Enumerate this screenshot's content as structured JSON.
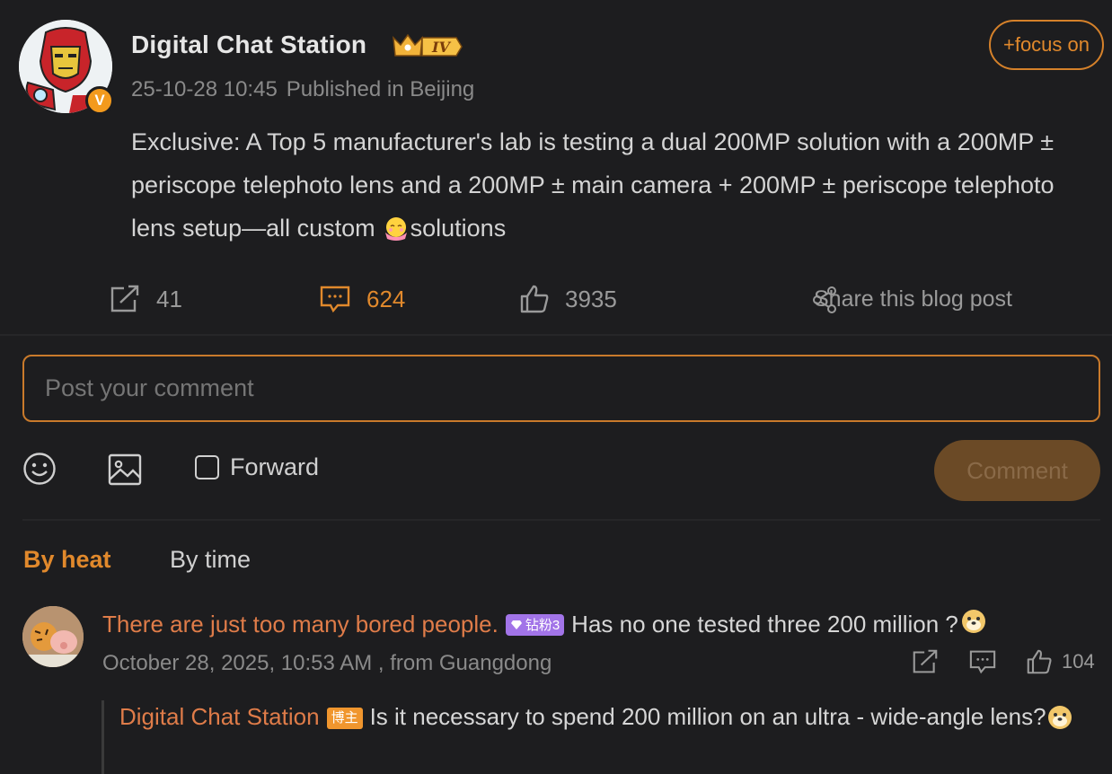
{
  "post": {
    "author": "Digital Chat Station",
    "level": "IV",
    "verified": "V",
    "time": "25-10-28 10:45",
    "location": "Published in Beijing",
    "follow_label": "+focus on",
    "text_main": "Exclusive: A Top 5 manufacturer's lab is testing a dual 200MP solution with a 200MP ± periscope telephoto lens and a 200MP ± main camera + 200MP ± periscope telephoto lens setup—all custom",
    "text_tail": "solutions"
  },
  "actions": {
    "reposts": "41",
    "comments": "624",
    "likes": "3935",
    "share_label": "Share this blog post"
  },
  "composer": {
    "placeholder": "Post your comment",
    "forward_label": "Forward",
    "submit_label": "Comment"
  },
  "sort_tabs": {
    "by_heat": "By heat",
    "by_time": "By time"
  },
  "comment": {
    "user": "There are just too many bored people.",
    "fan_badge": "钻粉3",
    "text": "Has no one tested three 200 million ?",
    "meta": "October 28, 2025, 10:53 AM , from Guangdong",
    "likes": "104"
  },
  "reply": {
    "user": "Digital Chat Station",
    "owner_badge": "博主",
    "text": "Is it necessary to spend 200 million on an ultra - wide-angle lens?"
  },
  "colors": {
    "accent": "#e1892c",
    "background": "#1d1d1f",
    "username": "#df7c49",
    "fan_badge": "#a274e8"
  }
}
